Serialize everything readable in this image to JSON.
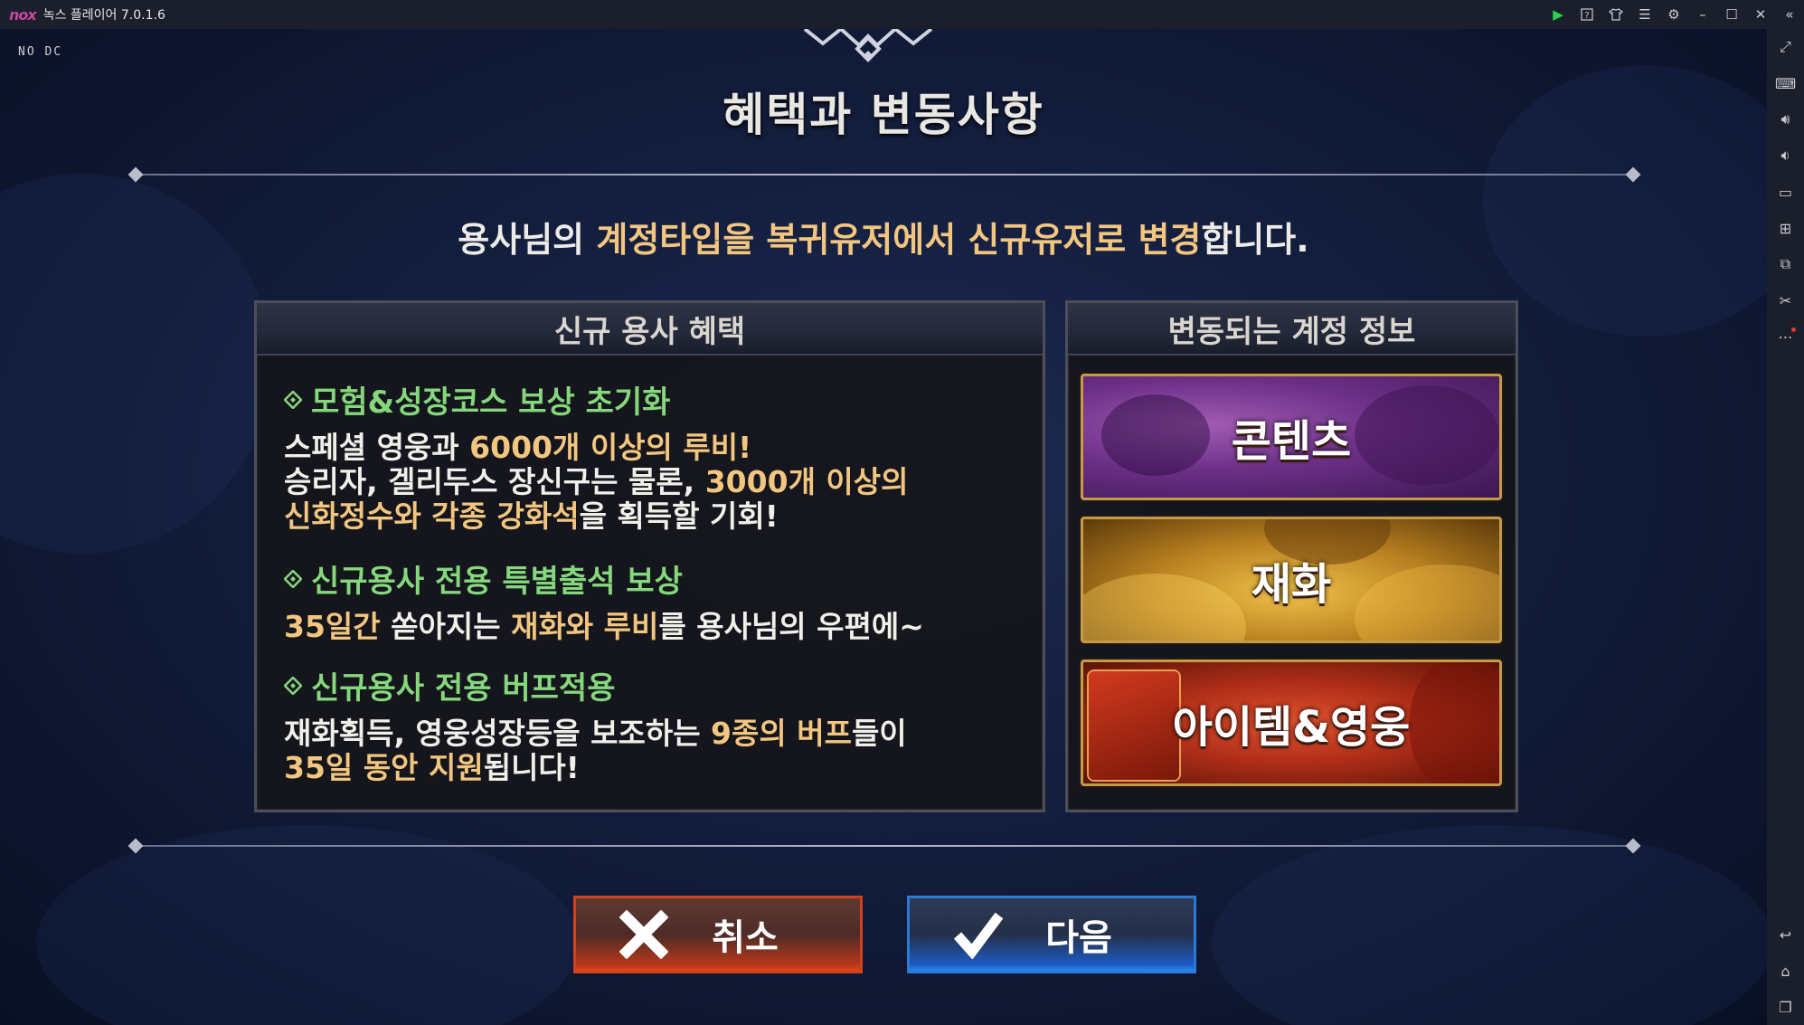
{
  "window": {
    "logo": "nox",
    "title": "녹스 플레이어 7.0.1.6",
    "controls": [
      "play-icon",
      "help-icon",
      "skin-icon",
      "menu-icon",
      "settings-icon",
      "minimize-icon",
      "maximize-icon",
      "close-icon",
      "collapse-sidebar-icon"
    ]
  },
  "sidebar": {
    "top_icons": [
      "fullscreen-icon",
      "keyboard-icon",
      "volume-up-icon",
      "volume-down-icon",
      "screen-icon",
      "apk-install-icon",
      "multi-instance-icon",
      "screenshot-scissors-icon",
      "more-icon"
    ],
    "bottom_icons": [
      "back-icon",
      "home-icon",
      "recent-apps-icon"
    ]
  },
  "game": {
    "overlay_tag": "NO DC",
    "dialog": {
      "title": "혜택과 변동사항",
      "subtitle": {
        "p1": "용사님의 ",
        "p2": "계정타입",
        "p3": "을 ",
        "p4": "복귀유저",
        "p5": "에서 ",
        "p6": "신규유저",
        "p7": "로 ",
        "p8": "변경",
        "p9": "합니다."
      },
      "benefits_panel": {
        "header": "신규 용사 혜택",
        "sections": [
          {
            "heading": "모험&성장코스 보상 초기화",
            "line1": {
              "a": "스페셜 영웅과 ",
              "b": "6000개 이상의 루비!"
            },
            "line2": {
              "a": "승리자, 겔리두스 장신구는 물론, ",
              "b": "3000개 이상의"
            },
            "line3": {
              "a": "신화정수와 각종 강화석",
              "b": "을 획득할 기회!"
            }
          },
          {
            "heading": "신규용사 전용 특별출석 보상",
            "line1": {
              "a": "35일간",
              "b": " 쏟아지는 ",
              "c": "재화와 루비",
              "d": "를 용사님의 우편에~"
            }
          },
          {
            "heading": "신규용사 전용 버프적용",
            "line1": {
              "a": "재화획득, 영웅성장등을 보조하는 ",
              "b": "9종의 버프",
              "c": "들이"
            },
            "line2": {
              "a": "35일 동안 지원",
              "b": "됩니다!"
            }
          }
        ]
      },
      "info_panel": {
        "header": "변동되는 계정 정보",
        "cards": [
          "콘텐츠",
          "재화",
          "아이템&영웅"
        ]
      },
      "buttons": {
        "cancel": "취소",
        "next": "다음"
      }
    }
  },
  "colors": {
    "highlight_gold": "#f3c680",
    "heading_green": "#85d77c",
    "cancel_red": "#d2411e",
    "next_blue": "#2a7ad6"
  }
}
